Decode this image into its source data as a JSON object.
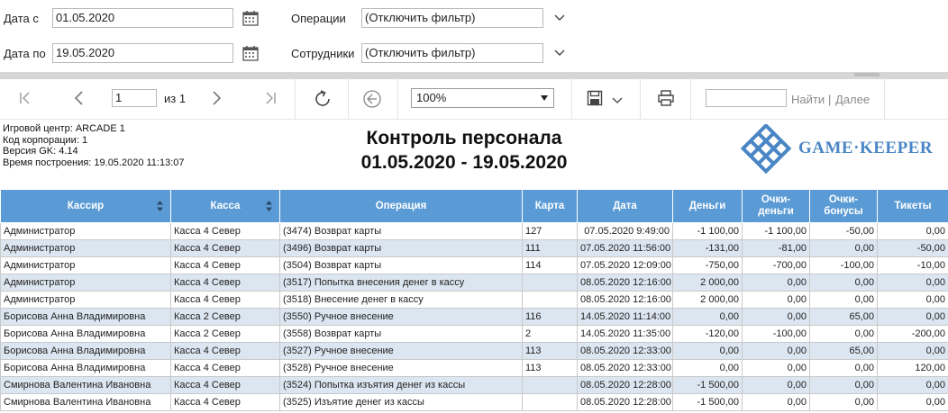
{
  "filters": {
    "date_from_label": "Дата с",
    "date_from_value": "01.05.2020",
    "date_to_label": "Дата по",
    "date_to_value": "19.05.2020",
    "operations_label": "Операции",
    "operations_value": "(Отключить фильтр)",
    "staff_label": "Сотрудники",
    "staff_value": "(Отключить фильтр)"
  },
  "toolbar": {
    "page_value": "1",
    "page_of": "из 1",
    "zoom": "100%",
    "find_label": "Найти",
    "find_sep": "|",
    "next_label": "Далее"
  },
  "report": {
    "meta": [
      "Игровой центр: ARCADE 1",
      "Код корпорации: 1",
      "Версия GK: 4.14",
      "Время построения: 19.05.2020 11:13:07"
    ],
    "title": "Контроль персонала",
    "period": "01.05.2020 - 19.05.2020",
    "logo_text": "GAME·KEEPER",
    "logo_color": "#4a86c5"
  },
  "table": {
    "headers": [
      "Кассир",
      "Касса",
      "Операция",
      "Карта",
      "Дата",
      "Деньги",
      "Очки-\nденьги",
      "Очки-\nбонусы",
      "Тикеты"
    ],
    "rows": [
      [
        "Администратор",
        "Касса 4 Север",
        "(3474) Возврат карты",
        "127",
        "07.05.2020 9:49:00",
        "-1 100,00",
        "-1 100,00",
        "-50,00",
        "0,00"
      ],
      [
        "Администратор",
        "Касса 4 Север",
        "(3496) Возврат карты",
        "111",
        "07.05.2020 11:56:00",
        "-131,00",
        "-81,00",
        "0,00",
        "-50,00"
      ],
      [
        "Администратор",
        "Касса 4 Север",
        "(3504) Возврат карты",
        "114",
        "07.05.2020 12:09:00",
        "-750,00",
        "-700,00",
        "-100,00",
        "-10,00"
      ],
      [
        "Администратор",
        "Касса 4 Север",
        "(3517) Попытка внесения денег в кассу",
        "",
        "08.05.2020 12:16:00",
        "2 000,00",
        "0,00",
        "0,00",
        "0,00"
      ],
      [
        "Администратор",
        "Касса 4 Север",
        "(3518) Внесение денег в кассу",
        "",
        "08.05.2020 12:16:00",
        "2 000,00",
        "0,00",
        "0,00",
        "0,00"
      ],
      [
        "Борисова Анна Владимировна",
        "Касса 2 Север",
        "(3550) Ручное внесение",
        "116",
        "14.05.2020 11:14:00",
        "0,00",
        "0,00",
        "65,00",
        "0,00"
      ],
      [
        "Борисова Анна Владимировна",
        "Касса 2 Север",
        "(3558) Возврат карты",
        "2",
        "14.05.2020 11:35:00",
        "-120,00",
        "-100,00",
        "0,00",
        "-200,00"
      ],
      [
        "Борисова Анна Владимировна",
        "Касса 4 Север",
        "(3527) Ручное внесение",
        "113",
        "08.05.2020 12:33:00",
        "0,00",
        "0,00",
        "65,00",
        "0,00"
      ],
      [
        "Борисова Анна Владимировна",
        "Касса 4 Север",
        "(3528) Ручное внесение",
        "113",
        "08.05.2020 12:33:00",
        "0,00",
        "0,00",
        "0,00",
        "120,00"
      ],
      [
        "Смирнова Валентина Ивановна",
        "Касса 4 Север",
        "(3524) Попытка изъятия денег из кассы",
        "",
        "08.05.2020 12:28:00",
        "-1 500,00",
        "0,00",
        "0,00",
        "0,00"
      ],
      [
        "Смирнова Валентина Ивановна",
        "Касса 4 Север",
        "(3525) Изъятие денег из кассы",
        "",
        "08.05.2020 12:28:00",
        "-1 500,00",
        "0,00",
        "0,00",
        "0,00"
      ]
    ]
  }
}
